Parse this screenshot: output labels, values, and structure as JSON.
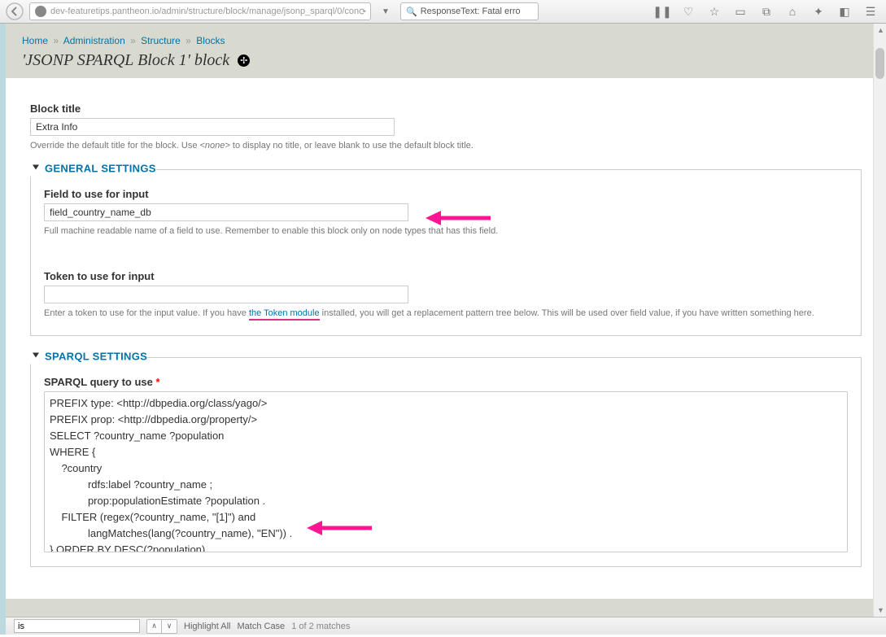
{
  "browser": {
    "url_display": "dev-featuretips.pantheon.io/admin/structure/block/manage/jsonp_sparql/0/con",
    "search_display": "ResponseText: Fatal erro",
    "icons": [
      "pause",
      "heart",
      "bookmark",
      "window",
      "history",
      "home",
      "devtools",
      "addons",
      "menu"
    ]
  },
  "breadcrumbs": [
    {
      "label": "Home"
    },
    {
      "label": "Administration"
    },
    {
      "label": "Structure"
    },
    {
      "label": "Blocks"
    }
  ],
  "page_title": "'JSONP SPARQL Block 1' block",
  "form": {
    "block_title": {
      "label": "Block title",
      "value": "Extra Info",
      "description_pre": "Override the default title for the block. Use ",
      "description_em": "<none>",
      "description_post": " to display no title, or leave blank to use the default block title."
    }
  },
  "general_settings": {
    "legend": "GENERAL SETTINGS",
    "field_input": {
      "label": "Field to use for input",
      "value": "field_country_name_db",
      "description": "Full machine readable name of a field to use. Remember to enable this block only on node types that has this field."
    },
    "token_input": {
      "label": "Token to use for input",
      "value": "",
      "description_pre": "Enter a token to use for the input value. If you have ",
      "description_link": "the Token module",
      "description_post": " installed, you will get a replacement pattern tree below. This will be used over field value, if you have written something here."
    }
  },
  "sparql_settings": {
    "legend": "SPARQL SETTINGS",
    "query": {
      "label": "SPARQL query to use",
      "value": "PREFIX type: <http://dbpedia.org/class/yago/>\nPREFIX prop: <http://dbpedia.org/property/>\nSELECT ?country_name ?population\nWHERE {\n    ?country\n             rdfs:label ?country_name ;\n             prop:populationEstimate ?population .\n    FILTER (regex(?country_name, \"[1]\") and\n             langMatches(lang(?country_name), \"EN\")) .\n} ORDER BY DESC(?population)"
    }
  },
  "findbar": {
    "field_value": "is",
    "highlight": "Highlight All",
    "match_case": "Match Case",
    "status": "1 of 2 matches"
  }
}
